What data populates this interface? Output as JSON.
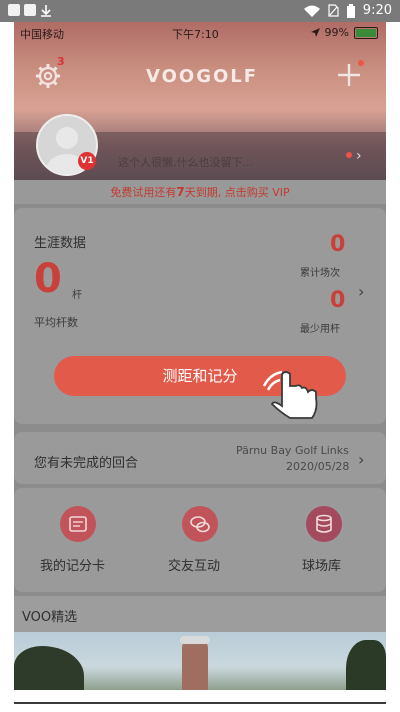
{
  "android_status": {
    "time": "9:20",
    "icons": [
      "notification-square-icon",
      "notification-square-icon",
      "download-icon",
      "wifi-icon",
      "no-sim-icon",
      "battery-icon"
    ]
  },
  "ios_status": {
    "carrier": "中国移动",
    "time": "下午7:10",
    "battery": "99%"
  },
  "header": {
    "settings_badge": "3",
    "logo": "VOOGOLF"
  },
  "profile": {
    "vip_badge": "V1",
    "signature": "这个人很懒,什么也没留下..."
  },
  "vip_banner": {
    "prefix": "免费试用还有",
    "days": "7",
    "suffix": "天到期, 点击购买 VIP"
  },
  "career": {
    "title": "生涯数据",
    "avg_value": "0",
    "avg_unit": "杆",
    "avg_label": "平均杆数",
    "rounds_value": "0",
    "rounds_label": "累计场次",
    "min_value": "0",
    "min_label": "最少用杆"
  },
  "main_button": "测距和记分",
  "unfinished": {
    "label": "您有未完成的回合",
    "course": "Pärnu Bay Golf Links",
    "date": "2020/05/28"
  },
  "features": [
    {
      "label": "我的记分卡",
      "icon": "scorecard-icon"
    },
    {
      "label": "交友互动",
      "icon": "chat-icon"
    },
    {
      "label": "球场库",
      "icon": "database-icon"
    }
  ],
  "section_title": "VOO精选",
  "colors": {
    "accent": "#e25a49",
    "number_red": "#c9403a",
    "overlay_gray": "#9a9a9a"
  }
}
